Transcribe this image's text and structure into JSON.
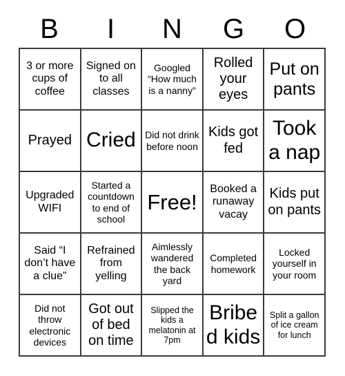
{
  "card": {
    "title": "BINGO",
    "header_letters": [
      "B",
      "I",
      "N",
      "G",
      "O"
    ],
    "grid_size": 5,
    "free_space": {
      "label": "Free!",
      "row": 3,
      "column": 3
    },
    "colors": {
      "background": "#ffffff",
      "text": "#000000",
      "grid_line": "#3a3a3a"
    },
    "rows": [
      {
        "cells": [
          {
            "text": "3 or more cups of coffee",
            "size": "m"
          },
          {
            "text": "Signed on to all classes",
            "size": "m"
          },
          {
            "text": "Googled “How much is a nanny”",
            "size": "s"
          },
          {
            "text": "Rolled your eyes",
            "size": "l"
          },
          {
            "text": "Put on pants",
            "size": "xl"
          }
        ]
      },
      {
        "cells": [
          {
            "text": "Prayed",
            "size": "l"
          },
          {
            "text": "Cried",
            "size": "xxl"
          },
          {
            "text": "Did not drink before noon",
            "size": "s"
          },
          {
            "text": "Kids got fed",
            "size": "l"
          },
          {
            "text": "Took a nap",
            "size": "xxl"
          }
        ]
      },
      {
        "cells": [
          {
            "text": "Upgraded WIFI",
            "size": "m"
          },
          {
            "text": "Started a countdown to end of school",
            "size": "s"
          },
          {
            "text": "Free!",
            "size": "free"
          },
          {
            "text": "Booked a runaway vacay",
            "size": "m"
          },
          {
            "text": "Kids put on pants",
            "size": "l"
          }
        ]
      },
      {
        "cells": [
          {
            "text": "Said “I don’t have a clue”",
            "size": "m"
          },
          {
            "text": "Refrained from yelling",
            "size": "m"
          },
          {
            "text": "Aimlessly wandered the back yard",
            "size": "s"
          },
          {
            "text": "Completed homework",
            "size": "s"
          },
          {
            "text": "Locked yourself in your room",
            "size": "s"
          }
        ]
      },
      {
        "cells": [
          {
            "text": "Did not throw electronic devices",
            "size": "s"
          },
          {
            "text": "Got out of bed on time",
            "size": "l"
          },
          {
            "text": "Slipped the kids a melatonin at 7pm",
            "size": "xs"
          },
          {
            "text": "Bribed kids",
            "size": "xxl"
          },
          {
            "text": "Split a gallon of ice cream for lunch",
            "size": "xs"
          }
        ]
      }
    ]
  }
}
